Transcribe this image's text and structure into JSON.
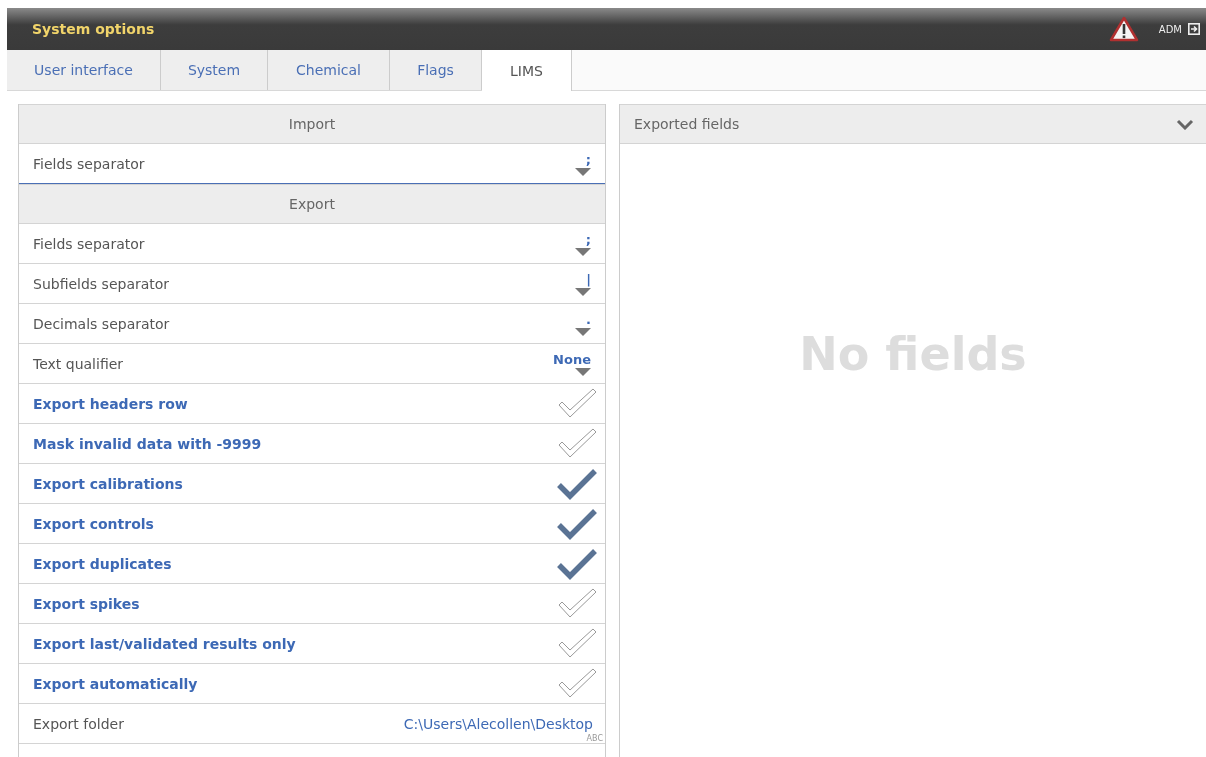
{
  "header": {
    "title": "System options",
    "user": "ADM"
  },
  "tabs": [
    {
      "label": "User interface",
      "selected": false
    },
    {
      "label": "System",
      "selected": false
    },
    {
      "label": "Chemical",
      "selected": false
    },
    {
      "label": "Flags",
      "selected": false
    },
    {
      "label": "LIMS",
      "selected": true
    }
  ],
  "sections": [
    {
      "title": "Import",
      "rows": [
        {
          "kind": "select",
          "label": "Fields separator",
          "value": ";",
          "focused": true
        }
      ]
    },
    {
      "title": "Export",
      "rows": [
        {
          "kind": "select",
          "label": "Fields separator",
          "value": ";",
          "focused": false
        },
        {
          "kind": "select",
          "label": "Subfields separator",
          "value": "|",
          "focused": false
        },
        {
          "kind": "select",
          "label": "Decimals separator",
          "value": ".",
          "focused": false
        },
        {
          "kind": "select",
          "label": "Text qualifier",
          "value": "None",
          "focused": false
        },
        {
          "kind": "check",
          "label": "Export headers row",
          "checked": false
        },
        {
          "kind": "check",
          "label": "Mask invalid data with -9999",
          "checked": false
        },
        {
          "kind": "check",
          "label": "Export calibrations",
          "checked": true
        },
        {
          "kind": "check",
          "label": "Export controls",
          "checked": true
        },
        {
          "kind": "check",
          "label": "Export duplicates",
          "checked": true
        },
        {
          "kind": "check",
          "label": "Export spikes",
          "checked": false
        },
        {
          "kind": "check",
          "label": "Export last/validated results only",
          "checked": false
        },
        {
          "kind": "check",
          "label": "Export automatically",
          "checked": false
        },
        {
          "kind": "text",
          "label": "Export folder",
          "value": "C:\\Users\\Alecollen\\Desktop",
          "hint": "ABC"
        }
      ]
    }
  ],
  "exported_fields": {
    "title": "Exported fields",
    "empty_text": "No fields"
  }
}
